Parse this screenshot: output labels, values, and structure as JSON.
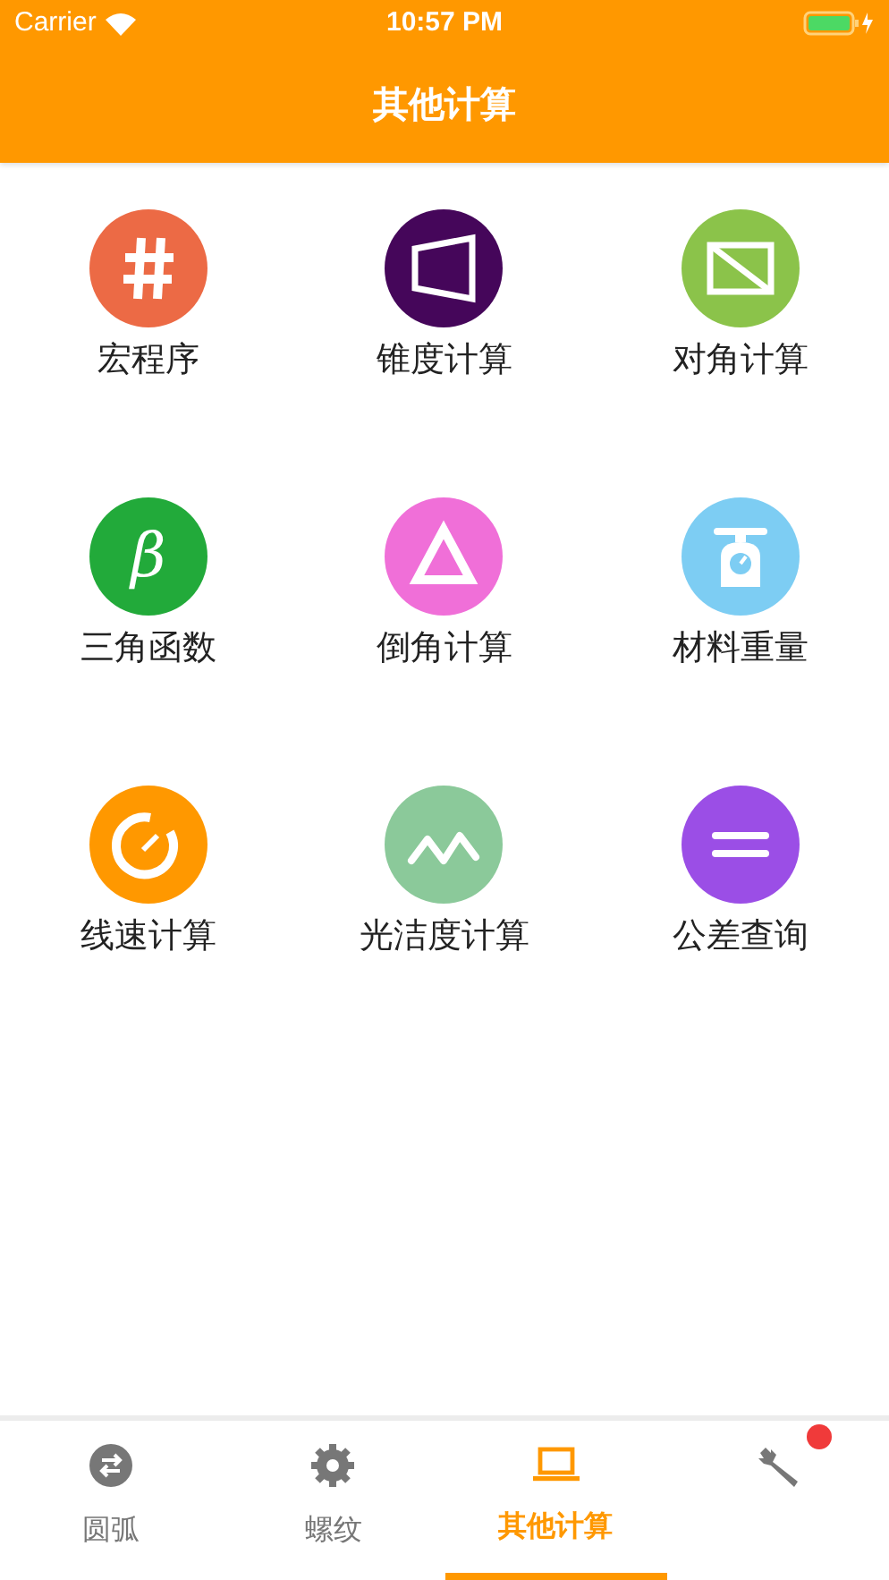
{
  "status_bar": {
    "carrier": "Carrier",
    "time": "10:57 PM"
  },
  "nav_bar": {
    "title": "其他计算"
  },
  "tools": [
    {
      "label": "宏程序",
      "kind": "hash",
      "color": "#ec6a45"
    },
    {
      "label": "锥度计算",
      "kind": "taper",
      "color": "#45065a"
    },
    {
      "label": "对角计算",
      "kind": "diagonal",
      "color": "#8bc34a"
    },
    {
      "label": "三角函数",
      "kind": "beta",
      "glyph": "β",
      "color": "#22aa3a"
    },
    {
      "label": "倒角计算",
      "kind": "triangle",
      "color": "#f06fd8"
    },
    {
      "label": "材料重量",
      "kind": "scale",
      "color": "#7dcdf3"
    },
    {
      "label": "线速计算",
      "kind": "gauge",
      "color": "#ff9800"
    },
    {
      "label": "光洁度计算",
      "kind": "wave",
      "color": "#8bc99a"
    },
    {
      "label": "公差查询",
      "kind": "equals",
      "color": "#9b4ee6"
    }
  ],
  "tab_bar": [
    {
      "label": "圆弧",
      "kind": "swap",
      "selected": false
    },
    {
      "label": "螺纹",
      "kind": "gear",
      "selected": false
    },
    {
      "label": "其他计算",
      "kind": "laptop",
      "selected": true
    },
    {
      "kind": "wrench",
      "selected": false,
      "badge": true
    }
  ]
}
